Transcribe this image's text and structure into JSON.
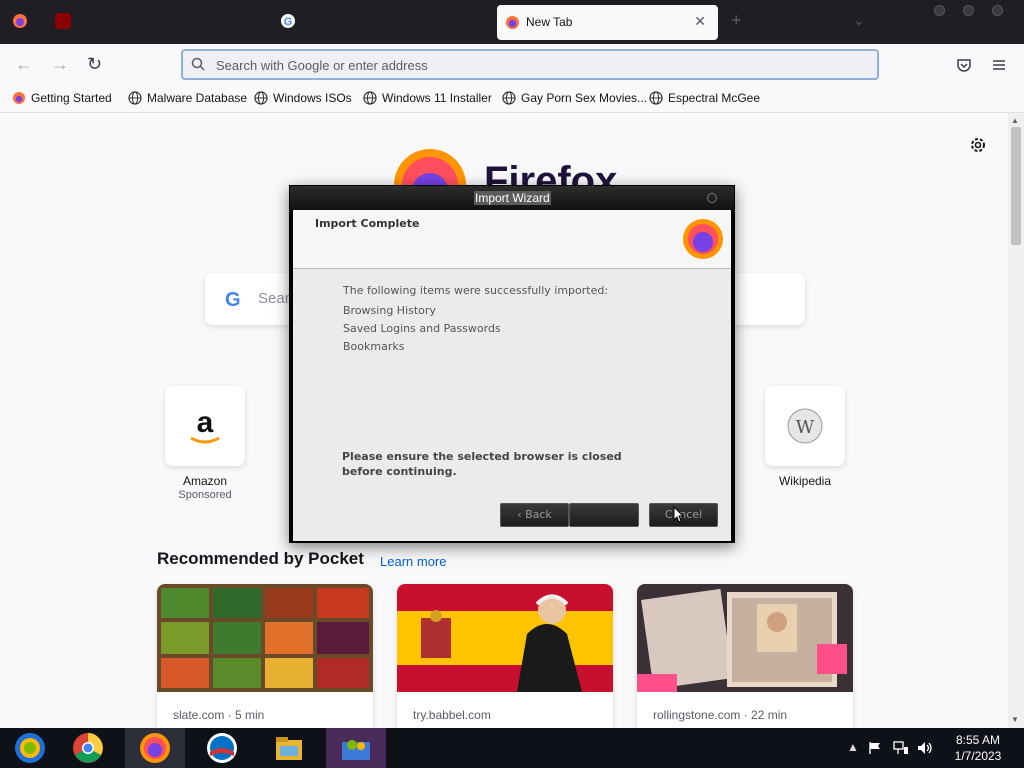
{
  "browser": {
    "active_tab_title": "New Tab",
    "tab_close_glyph": "✕",
    "new_tab_glyph": "+",
    "tabs_list_glyph": "⌄",
    "url_placeholder": "Search with Google or enter address",
    "bookmarks": [
      {
        "label": "Getting Started",
        "icon": "firefox-icon"
      },
      {
        "label": "Malware Database",
        "icon": "globe-icon"
      },
      {
        "label": "Windows ISOs",
        "icon": "globe-icon"
      },
      {
        "label": "Windows 11 Installer",
        "icon": "globe-icon"
      },
      {
        "label": "Gay Porn Sex Movies...",
        "icon": "globe-icon"
      },
      {
        "label": "Espectral McGee",
        "icon": "globe-icon"
      }
    ]
  },
  "newtab": {
    "brand": "Firefox",
    "search_placeholder": "Sear",
    "tiles": [
      {
        "label": "Amazon",
        "sub": "Sponsored",
        "icon": "amazon-logo"
      },
      {
        "label": "Wikipedia",
        "sub": "",
        "icon": "wikipedia-logo"
      }
    ],
    "pocket_heading": "Recommended by Pocket",
    "pocket_learn_more": "Learn more",
    "cards": [
      {
        "source": "slate.com · 5 min",
        "image": "vegetables-crates"
      },
      {
        "source": "try.babbel.com",
        "image": "spain-flag-man"
      },
      {
        "source": "rollingstone.com · 22 min",
        "image": "passport-book"
      }
    ]
  },
  "dialog": {
    "title": "Import Wizard",
    "heading": "Import Complete",
    "intro": "The following items were successfully imported:",
    "items": [
      "Browsing History",
      "Saved Logins and Passwords",
      "Bookmarks"
    ],
    "warning": "Please ensure the selected browser is closed before continuing.",
    "back_label": "‹ Back",
    "next_label": "",
    "cancel_label": "Cancel"
  },
  "taskbar": {
    "apps": [
      "start-icon",
      "chrome-icon",
      "firefox-icon",
      "outlook-icon",
      "file-explorer-icon",
      "users-icon"
    ],
    "time": "8:55 AM",
    "date": "1/7/2023"
  },
  "colors": {
    "accent": "#0061e0",
    "tabbar": "#1f1e25",
    "dialog_frame": "#000000"
  }
}
